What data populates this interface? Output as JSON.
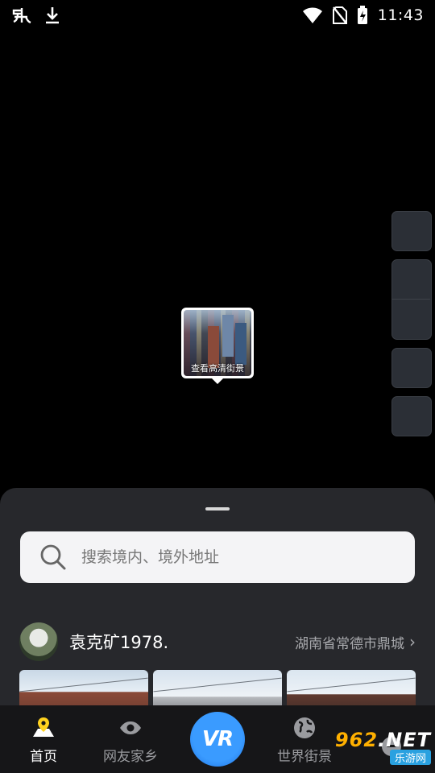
{
  "status_bar": {
    "left_icons": [
      "app-notification-icon",
      "download-icon"
    ],
    "right_icons": [
      "wifi-icon",
      "no-sim-icon",
      "battery-charging-icon"
    ],
    "time": "11:43"
  },
  "map": {
    "side_buttons": [
      "map-tool-1",
      "map-tool-2",
      "map-tool-3",
      "map-tool-4",
      "map-tool-5"
    ],
    "pin_caption": "查看高清街景"
  },
  "sheet": {
    "search_placeholder": "搜索境内、境外地址",
    "post": {
      "username": "袁克矿1978.",
      "location": "湖南省常德市鼎城",
      "chevron": "›"
    }
  },
  "tabs": [
    {
      "label": "首页",
      "icon": "map-pin-icon",
      "active": true
    },
    {
      "label": "网友家乡",
      "icon": "eye-icon",
      "active": false
    },
    {
      "label": "",
      "icon": "vr-icon",
      "active": false
    },
    {
      "label": "世界街景",
      "icon": "globe-icon",
      "active": false
    },
    {
      "label": "",
      "icon": "profile-icon",
      "active": false
    }
  ],
  "vr_label": "VR",
  "watermark": {
    "top_a": "962",
    "top_b": ".NET",
    "bottom": "乐游网"
  },
  "colors": {
    "accent": "#ffd21e",
    "vr_blue": "#2f8cff",
    "sheet_bg": "#27282c"
  }
}
